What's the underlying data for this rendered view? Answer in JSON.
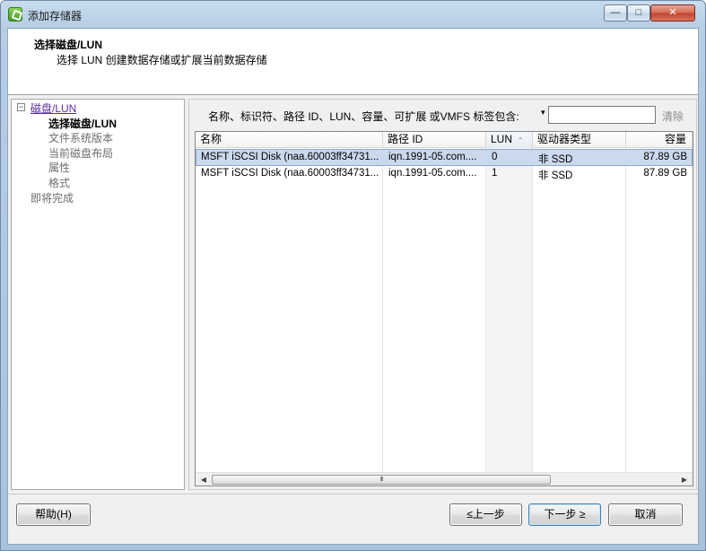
{
  "window": {
    "title": "添加存储器",
    "min_glyph": "—",
    "max_glyph": "□",
    "close_glyph": "✕"
  },
  "header": {
    "title": "选择磁盘/LUN",
    "subtitle": "选择 LUN 创建数据存储或扩展当前数据存储"
  },
  "nav": {
    "collapse_glyph": "−",
    "items": [
      {
        "label": "磁盘/LUN",
        "state": "link"
      },
      {
        "label": "选择磁盘/LUN",
        "state": "current"
      },
      {
        "label": "文件系统版本",
        "state": "muted"
      },
      {
        "label": "当前磁盘布局",
        "state": "muted"
      },
      {
        "label": "属性",
        "state": "muted"
      },
      {
        "label": "格式",
        "state": "muted"
      },
      {
        "label": "即将完成",
        "state": "muted"
      }
    ]
  },
  "filter": {
    "label": "名称、标识符、路径 ID、LUN、容量、可扩展 或VMFS 标签包含:",
    "dropdown_glyph": "▾",
    "value": "",
    "placeholder": "",
    "clear_label": "清除"
  },
  "table": {
    "columns": [
      "名称",
      "路径 ID",
      "LUN",
      "驱动器类型",
      "容量"
    ],
    "sort_glyph": "⌃",
    "sorted_column": "LUN",
    "rows": [
      {
        "name": "MSFT iSCSI Disk (naa.60003ff34731...",
        "path_id": "iqn.1991-05.com....",
        "lun": "0",
        "drive_type": "非 SSD",
        "capacity": "87.89 GB",
        "selected": true
      },
      {
        "name": "MSFT iSCSI Disk (naa.60003ff34731...",
        "path_id": "iqn.1991-05.com....",
        "lun": "1",
        "drive_type": "非 SSD",
        "capacity": "87.89 GB",
        "selected": false
      }
    ],
    "scrollbar": {
      "left_glyph": "◀",
      "right_glyph": "▶",
      "thumb_grip": "III"
    }
  },
  "footer": {
    "help_label": "帮助(H)",
    "back_label": "≤上一步",
    "next_label": "下一步 ≥",
    "cancel_label": "取消"
  },
  "colors": {
    "selected_row": "#cad9ec",
    "nav_link": "#5a2ca0",
    "close_button": "#c2432c"
  }
}
